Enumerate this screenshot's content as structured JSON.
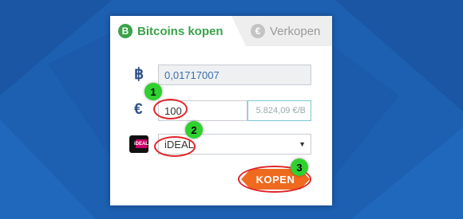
{
  "tabs": {
    "buy_label": "Bitcoins kopen",
    "sell_label": "Verkopen"
  },
  "form": {
    "btc_symbol": "฿",
    "btc_amount": "0,01717007",
    "eur_symbol": "€",
    "eur_amount": "100",
    "rate": "5.824,09 €/B",
    "bank_option": "iDEAL",
    "ideal_icon_text": "iDEAL",
    "buy_label": "KOPEN"
  },
  "steps": {
    "step1": "1",
    "step2": "2",
    "step3": "3"
  },
  "colors": {
    "background": "#1d5fb0",
    "accent_green": "#3aa34a",
    "button_orange": "#ee6a1f",
    "highlight_red": "#e0262b",
    "marker_green": "#2fd12f"
  }
}
